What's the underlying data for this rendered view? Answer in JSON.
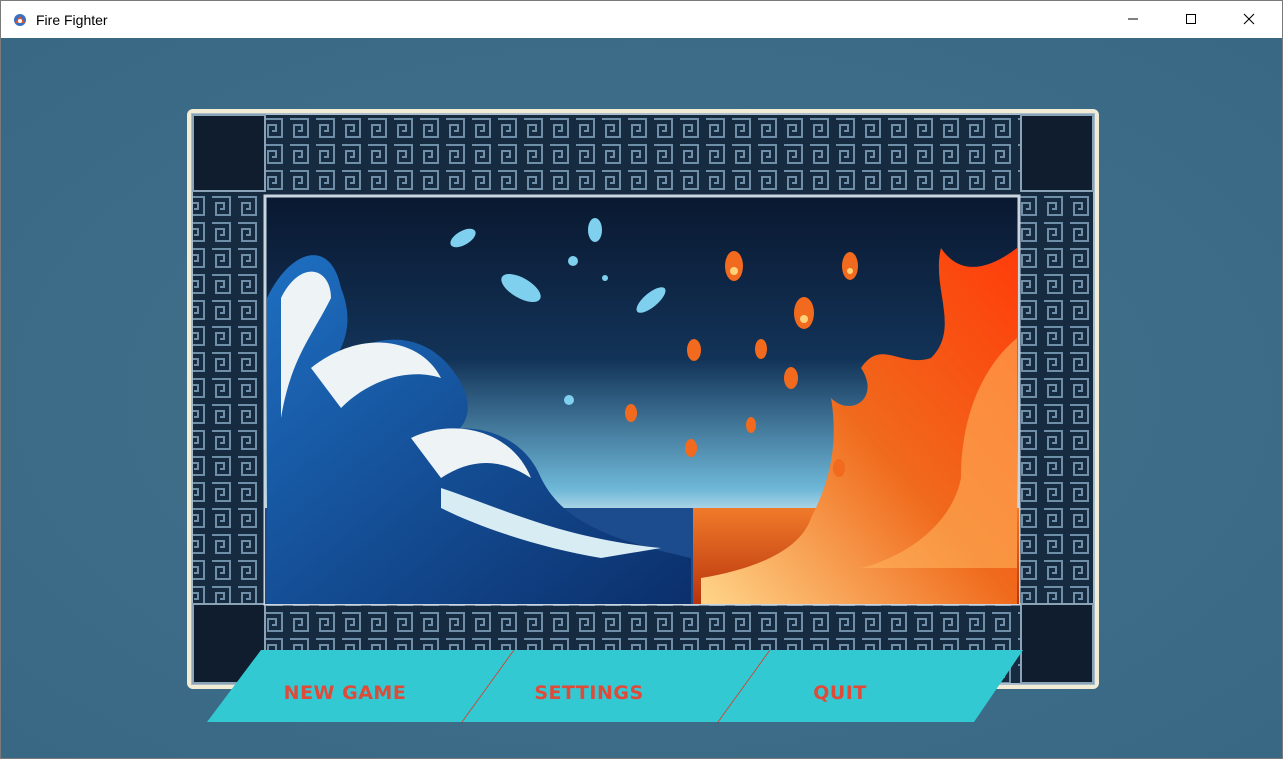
{
  "window": {
    "title": "Fire Fighter",
    "app_icon": "fire-fighter-icon",
    "controls": {
      "minimize": "minimize-icon",
      "maximize": "maximize-icon",
      "close": "close-icon"
    }
  },
  "colors": {
    "background": "#3e6d87",
    "menu_bar": "#33c9d2",
    "menu_text": "#e04a38",
    "frame_border": "#f2ecd6",
    "water": "#1d66b0",
    "fire": "#ee5a17"
  },
  "menu": {
    "new_game": "NEW GAME",
    "settings": "SETTINGS",
    "quit": "QUIT"
  }
}
